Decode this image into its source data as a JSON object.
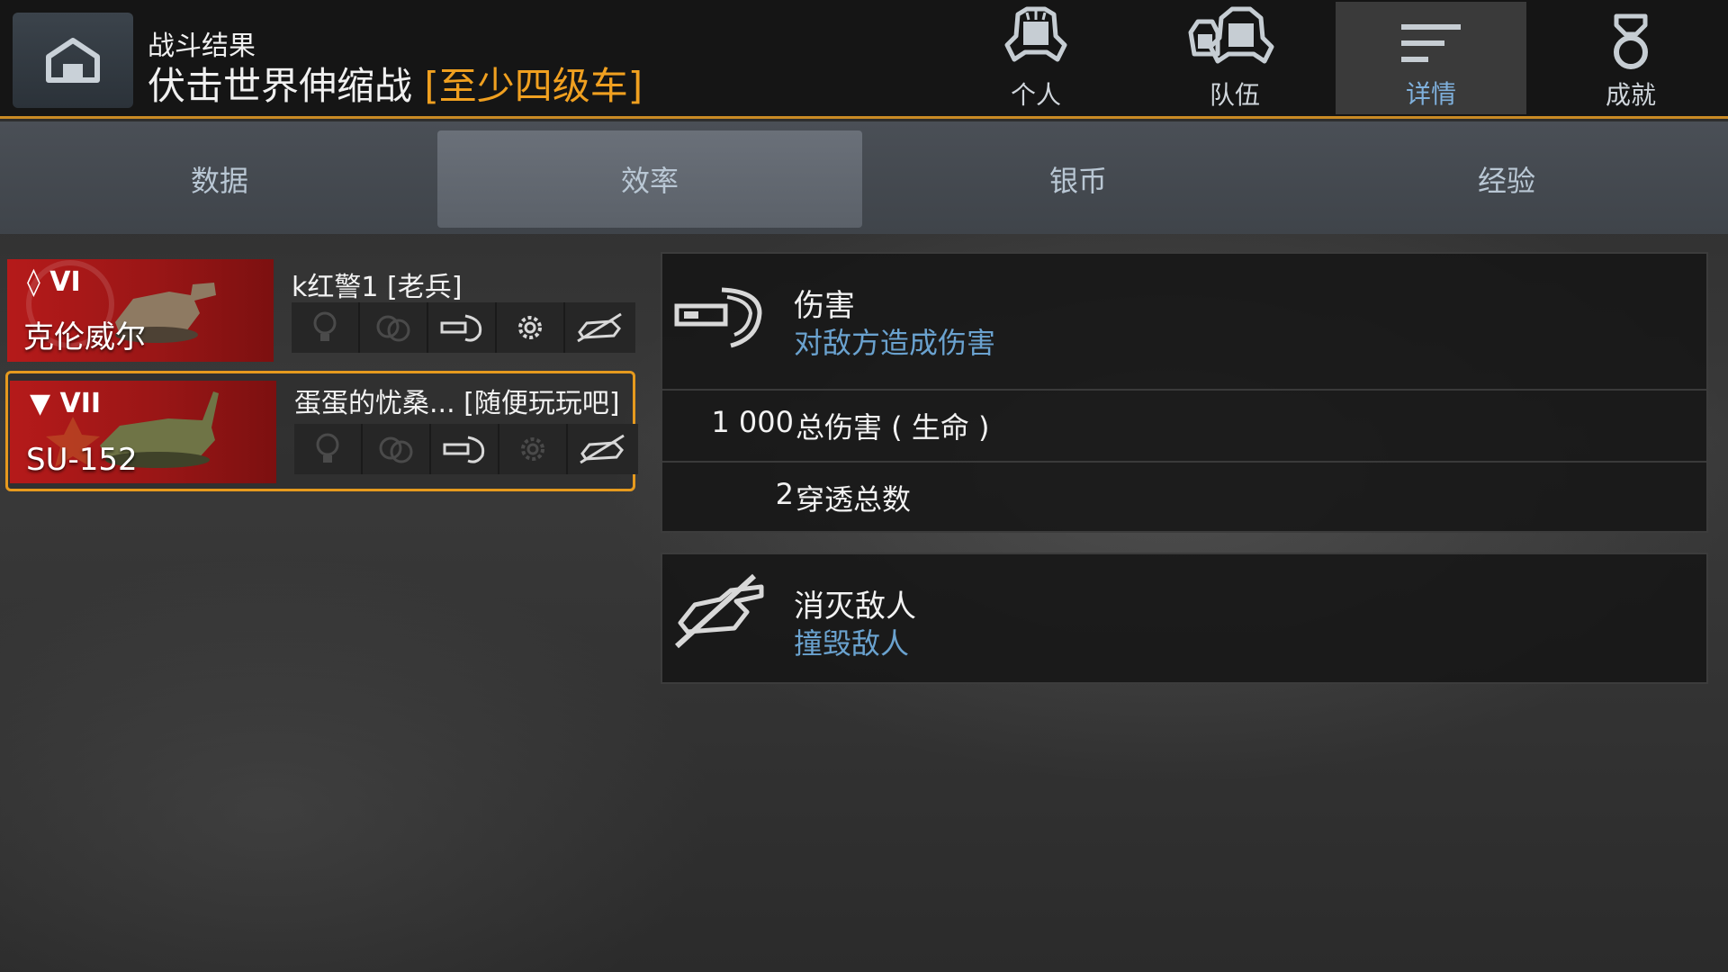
{
  "header": {
    "subtitle": "战斗结果",
    "mode_name": "伏击世界伸缩战",
    "mode_tag": "[至少四级车]",
    "nav": [
      {
        "label": "个人",
        "icon": "personal-helmet-icon",
        "active": false
      },
      {
        "label": "队伍",
        "icon": "team-helmets-icon",
        "active": false
      },
      {
        "label": "详情",
        "icon": "details-lines-icon",
        "active": true
      },
      {
        "label": "成就",
        "icon": "medal-icon",
        "active": false
      }
    ]
  },
  "tabs": [
    {
      "label": "数据",
      "active": false
    },
    {
      "label": "效率",
      "active": true
    },
    {
      "label": "银币",
      "active": false
    },
    {
      "label": "经验",
      "active": false
    }
  ],
  "players": [
    {
      "tier": "VI",
      "tank": "克伦威尔",
      "name": "k红警1 [老兵]",
      "selected": false
    },
    {
      "tier": "VII",
      "tank": "SU-152",
      "name": "蛋蛋的忧桑... [随便玩玩吧]",
      "selected": true
    }
  ],
  "panels": {
    "damage": {
      "title": "伤害",
      "subtitle": "对敌方造成伤害",
      "stats": [
        {
          "value": "1 000",
          "label": "总伤害 ( 生命 )"
        },
        {
          "value": "2",
          "label": "穿透总数"
        }
      ]
    },
    "destroy": {
      "title": "消灭敌人",
      "subtitle": "撞毁敌人"
    }
  },
  "colors": {
    "accent": "#f0a020",
    "header_line": "#c98a24",
    "subtitle_blue": "#6aa2cf",
    "tank_card_red": "#b51a1a"
  }
}
